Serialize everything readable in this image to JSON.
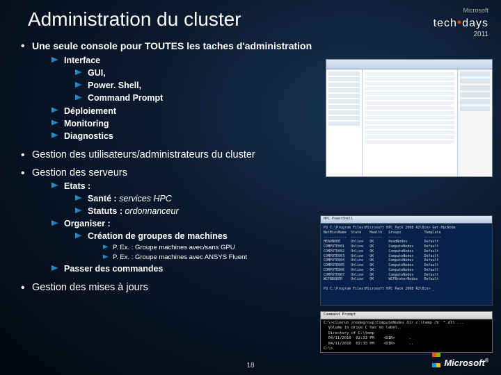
{
  "title": "Administration du cluster",
  "branding": {
    "company": "Microsoft",
    "event": "tech",
    "event2": "days",
    "year": "2011"
  },
  "page_number": "18",
  "footer_logo": "Microsoft",
  "bullets": {
    "b1": {
      "head": "Une seule console pour TOUTES les taches d'administration",
      "interface": "Interface",
      "gui": "GUI,",
      "ps": "Power. Shell,",
      "cmd": "Command Prompt",
      "deploy": "Déploiement",
      "monitor": "Monitoring",
      "diag": "Diagnostics"
    },
    "b2": {
      "text": "Gestion des utilisateurs/administrateurs du cluster"
    },
    "b3": {
      "text": "Gestion des serveurs",
      "etats": "Etats :",
      "sante_k": "Santé   : ",
      "sante_v": "services HPC",
      "stat_k": "Statuts : ",
      "stat_v": "ordonnanceur",
      "org": "Organiser :",
      "crea": "Création de groupes de machines",
      "ex1": "P. Ex. : Groupe machines avec/sans GPU",
      "ex2": "P. Ex. : Groupe machines avec ANSYS Fluent",
      "pass": "Passer des commandes"
    },
    "b4": {
      "text": "Gestion des mises à jours"
    }
  },
  "shot2_title": "HPC PowerShell",
  "shot2_text": "PS C:\\Program Files\\Microsoft HPC Pack 2008 R2\\Bin> Get-HpcNode\nNetBiosName  State    Health   Groups           Template\n-----------  -----    ------   ------           --------\nHEADNODE     Online   OK       HeadNodes        Default\nCOMPUTE001   Online   OK       ComputeNodes     Default\nCOMPUTE002   Online   OK       ComputeNodes     Default\nCOMPUTE003   Online   OK       ComputeNodes     Default\nCOMPUTE004   Online   OK       ComputeNodes     Default\nCOMPUTE005   Online   OK       ComputeNodes     Default\nCOMPUTE006   Online   OK       ComputeNodes     Default\nCOMPUTE007   Online   OK       ComputeNodes     Default\nWCFBROKER    Online   OK       WCFBrokerNodes   Default\n\nPS C:\\Program Files\\Microsoft HPC Pack 2008 R2\\Bin> _",
  "shot3_title": "Command Prompt",
  "shot3_text": "C:\\>clusrun /nodegroup:ComputeNodes dir c:\\temp /b  *.dll ...\n  Volume in drive C has no label.\n  Directory of C:\\temp\n  04/11/2010  02:33 PM    <DIR>      .\n  04/11/2010  02:33 PM    <DIR>      ..\nC:\\>"
}
